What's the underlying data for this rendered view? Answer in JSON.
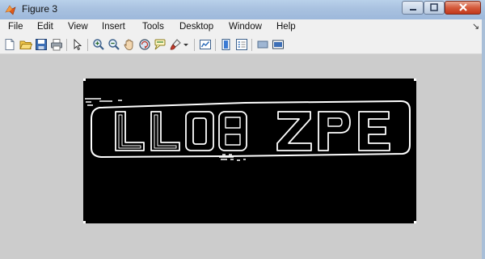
{
  "window": {
    "title": "Figure 3"
  },
  "menu": [
    "File",
    "Edit",
    "View",
    "Insert",
    "Tools",
    "Desktop",
    "Window",
    "Help"
  ],
  "toolbar": [
    "new-figure",
    "open-file",
    "save-figure",
    "print-figure",
    "edit-plot",
    "zoom-in",
    "zoom-out",
    "pan",
    "rotate-3d",
    "data-cursor",
    "brush",
    "link-plot",
    "colorbar",
    "legend",
    "hide-plot-tools",
    "show-plot-tools"
  ],
  "colors": {
    "figure_background": "#cccccc",
    "axes_background": "#000000",
    "edge_lines": "#ffffff"
  },
  "image": {
    "plate_text": "LL08 ZPE"
  }
}
